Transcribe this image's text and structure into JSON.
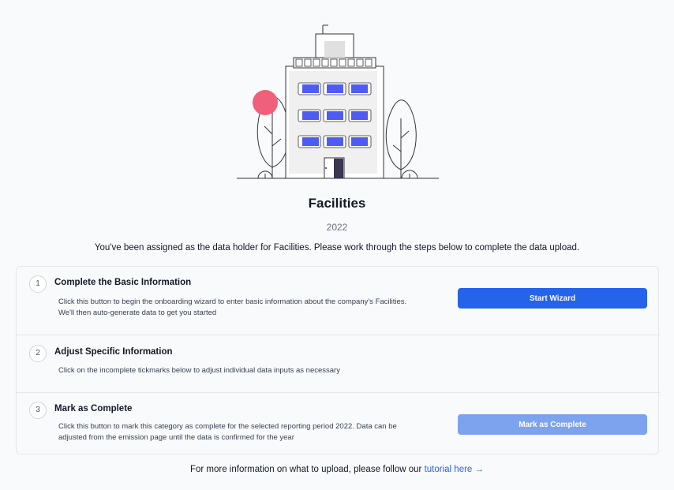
{
  "page": {
    "title": "Facilities",
    "year": "2022",
    "intro": "You've been assigned as the data holder for Facilities. Please work through the steps below to complete the data upload."
  },
  "steps": [
    {
      "number": "1",
      "title": "Complete the Basic Information",
      "description_lines": [
        "Click this button to begin the onboarding wizard to enter basic information about the company's Facilities.",
        "We'll then auto-generate data to get you started"
      ],
      "button_label": "Start Wizard"
    },
    {
      "number": "2",
      "title": "Adjust Specific Information",
      "description_lines": [
        "Click on the incomplete tickmarks below to adjust individual data inputs as necessary"
      ]
    },
    {
      "number": "3",
      "title": "Mark as Complete",
      "description_lines": [
        "Click this button to mark this category as complete for the selected reporting period 2022. Data can be",
        "adjusted from the emission page until the data is confirmed for the year"
      ],
      "button_label": "Mark as Complete",
      "button_disabled": true
    }
  ],
  "footer": {
    "text": "For more information on what to upload, please follow our",
    "link_label": "tutorial here",
    "link_arrow": "→"
  },
  "colors": {
    "primary": "#2563eb",
    "primary_disabled": "#7da2ee",
    "window_blue": "#4f5bf5",
    "accent_pink": "#f0607a",
    "door": "#3a3551"
  },
  "illustration": {
    "icon": "office-building-illustration"
  }
}
